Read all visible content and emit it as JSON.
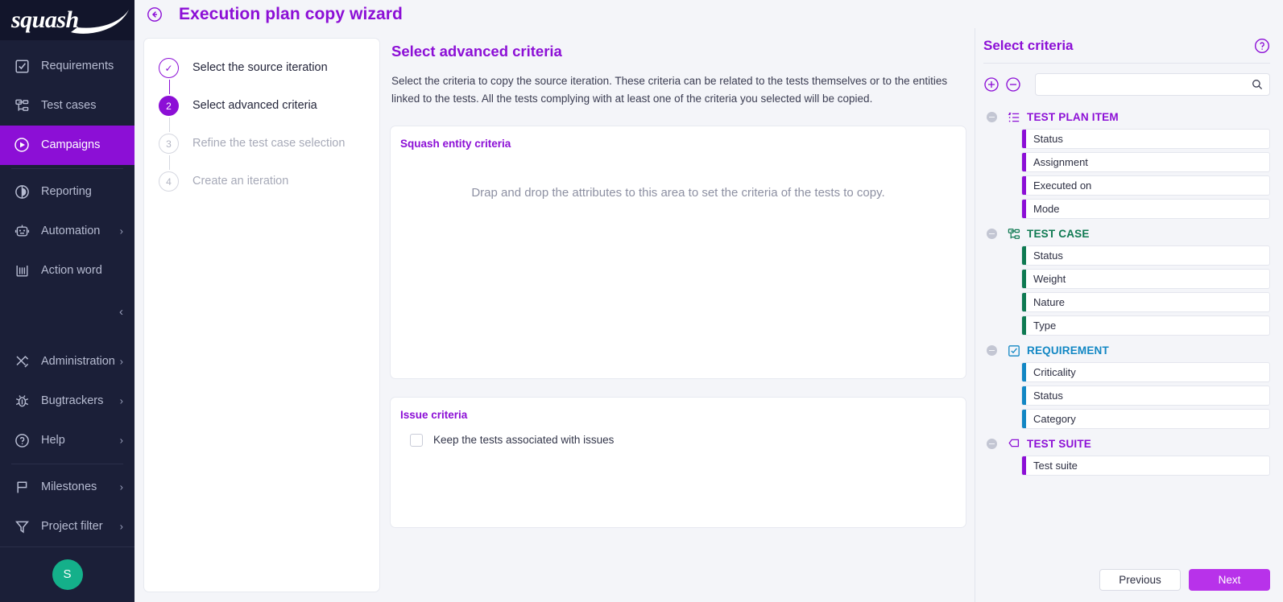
{
  "brand": {
    "logo_text": "squash"
  },
  "sidebar": {
    "items": [
      {
        "label": "Requirements",
        "icon": "requirements-icon",
        "active": false,
        "chevron": false
      },
      {
        "label": "Test cases",
        "icon": "test-cases-icon",
        "active": false,
        "chevron": false
      },
      {
        "label": "Campaigns",
        "icon": "campaigns-icon",
        "active": true,
        "chevron": false
      },
      {
        "label": "Reporting",
        "icon": "reporting-icon",
        "active": false,
        "chevron": false
      },
      {
        "label": "Automation",
        "icon": "automation-icon",
        "active": false,
        "chevron": true
      },
      {
        "label": "Action word",
        "icon": "action-word-icon",
        "active": false,
        "chevron": false
      },
      {
        "label": "Administration",
        "icon": "administration-icon",
        "active": false,
        "chevron": true
      },
      {
        "label": "Bugtrackers",
        "icon": "bugtrackers-icon",
        "active": false,
        "chevron": true
      },
      {
        "label": "Help",
        "icon": "help-icon",
        "active": false,
        "chevron": true
      },
      {
        "label": "Milestones",
        "icon": "milestones-icon",
        "active": false,
        "chevron": true
      },
      {
        "label": "Project filter",
        "icon": "project-filter-icon",
        "active": false,
        "chevron": true
      }
    ],
    "collapse_icon": "chevron-left-icon",
    "avatar_initial": "S"
  },
  "header": {
    "back_icon": "back-arrow-icon",
    "title": "Execution plan copy wizard"
  },
  "stepper": {
    "steps": [
      {
        "marker": "✓",
        "label": "Select the source iteration",
        "state": "done"
      },
      {
        "marker": "2",
        "label": "Select advanced criteria",
        "state": "current"
      },
      {
        "marker": "3",
        "label": "Refine the test case selection",
        "state": "todo"
      },
      {
        "marker": "4",
        "label": "Create an iteration",
        "state": "todo"
      }
    ]
  },
  "content": {
    "title": "Select advanced criteria",
    "description": "Select the criteria to copy the source iteration. These criteria can be related to the tests themselves or to the entities linked to the tests. All the tests complying with at least one of the criteria you selected will be copied.",
    "entity_panel": {
      "title": "Squash entity criteria",
      "dropzone_text": "Drap and drop the attributes to this area to set the criteria of the tests to copy."
    },
    "issue_panel": {
      "title": "Issue criteria",
      "checkbox_label": "Keep the tests associated with issues",
      "checked": false
    }
  },
  "right_panel": {
    "title": "Select criteria",
    "help_icon": "help-circle-icon",
    "expand_all_icon": "plus-circle-icon",
    "collapse_all_icon": "minus-circle-icon",
    "search": {
      "value": "",
      "placeholder": "",
      "icon": "search-icon"
    },
    "groups": [
      {
        "name": "TEST PLAN ITEM",
        "icon": "test-plan-item-icon",
        "color": "#8c0fd6",
        "expanded": true,
        "items": [
          "Status",
          "Assignment",
          "Executed on",
          "Mode"
        ]
      },
      {
        "name": "TEST CASE",
        "icon": "test-case-icon",
        "color": "#0f7a52",
        "expanded": true,
        "items": [
          "Status",
          "Weight",
          "Nature",
          "Type"
        ]
      },
      {
        "name": "REQUIREMENT",
        "icon": "requirement-icon",
        "color": "#1287c4",
        "expanded": true,
        "items": [
          "Criticality",
          "Status",
          "Category"
        ]
      },
      {
        "name": "TEST SUITE",
        "icon": "test-suite-icon",
        "color": "#8c0fd6",
        "expanded": true,
        "items": [
          "Test suite"
        ]
      }
    ],
    "footer": {
      "previous_label": "Previous",
      "next_label": "Next"
    }
  },
  "colors": {
    "brand_purple": "#8c0fd6",
    "next_button": "#b832ea",
    "sidebar_bg": "#1b1f38",
    "avatar_green": "#14b08a",
    "test_case_green": "#0f7a52",
    "requirement_blue": "#1287c4"
  }
}
